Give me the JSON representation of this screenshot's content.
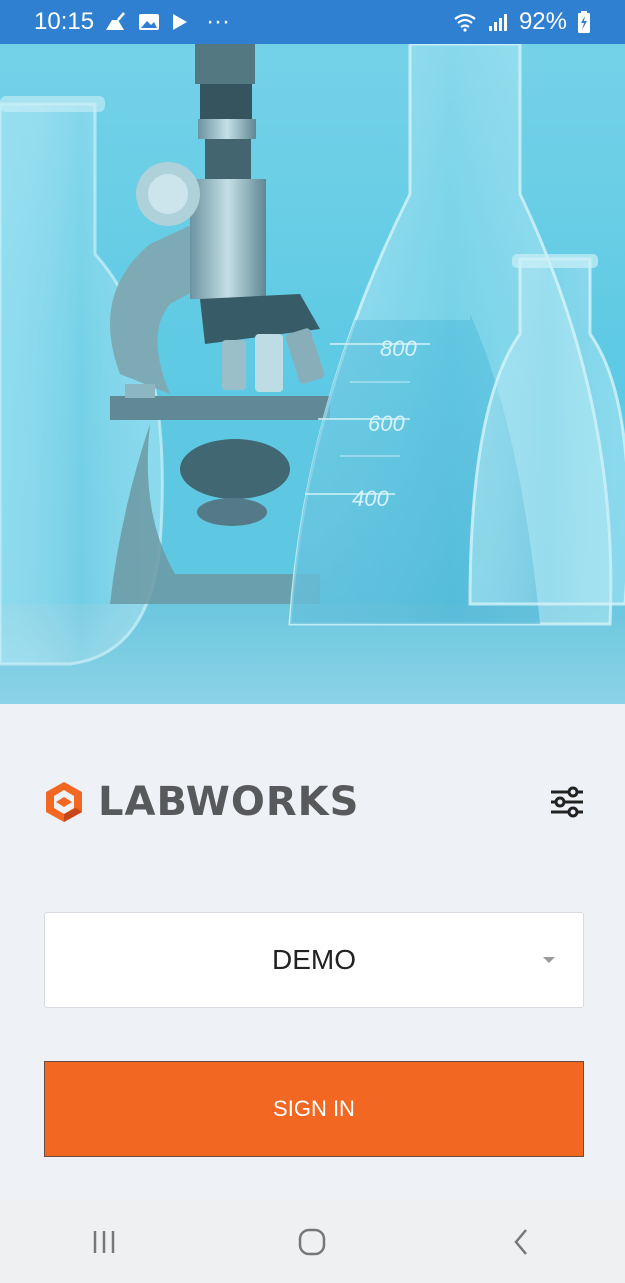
{
  "status_bar": {
    "time": "10:15",
    "battery": "92%",
    "left_icons": [
      "clean-icon",
      "gallery-icon",
      "play-store-icon",
      "more-notifications-icon"
    ],
    "right_icons": [
      "wifi-icon",
      "signal-icon",
      "battery-charging-icon"
    ],
    "overflow": "···",
    "background": "#2f80d1"
  },
  "hero": {
    "beaker_marks": [
      "800",
      "600",
      "400"
    ]
  },
  "brand": {
    "name": "LABWORKS",
    "accent": "#f26722",
    "text_color": "#58595b"
  },
  "settings": {
    "icon": "sliders-icon"
  },
  "environment_select": {
    "value": "DEMO",
    "icon": "caret-down-icon"
  },
  "signin": {
    "label": "SIGN IN",
    "color": "#f26722"
  },
  "nav_bar": {
    "buttons": [
      "recent-apps-icon",
      "home-icon",
      "back-icon"
    ]
  }
}
